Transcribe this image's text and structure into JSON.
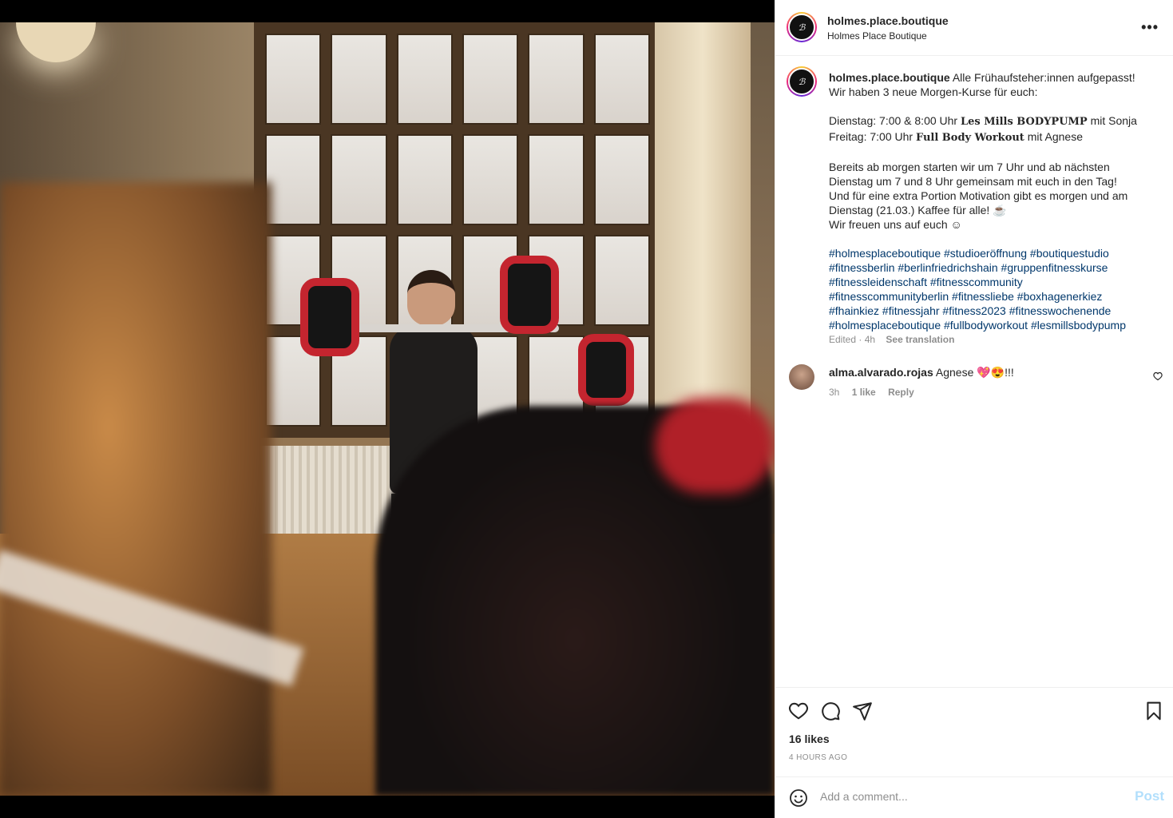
{
  "post": {
    "username": "holmes.place.boutique",
    "subtitle": "Holmes Place Boutique",
    "more": "•••",
    "avatar_text": "ℬ"
  },
  "caption": {
    "username": "holmes.place.boutique",
    "line1": " Alle Frühaufsteher:innen aufgepasst!",
    "line2": "Wir haben 3 neue Morgen-Kurse für euch:",
    "tue_a": "Dienstag: 7:00 & 8:00 Uhr ",
    "tue_b": "Les Mills BODYPUMP",
    "tue_c": " mit Sonja",
    "fri_a": "Freitag: 7:00 Uhr ",
    "fri_b": "Full Body Workout",
    "fri_c": " mit Agnese",
    "p1": "Bereits ab morgen starten wir um 7 Uhr und ab nächsten",
    "p2": "Dienstag um 7 und 8 Uhr gemeinsam mit euch in den Tag!",
    "p3": "Und für eine extra Portion Motivation gibt es morgen und am",
    "p4": "Dienstag (21.03.) Kaffee für alle! ☕",
    "p5": "Wir freuen uns auf euch ☺",
    "tags": [
      "#holmesplaceboutique #studioeröffnung #boutiquestudio",
      "#fitnessberlin #berlinfriedrichshain #gruppenfitnesskurse",
      "#fitnessleidenschaft #fitnesscommunity",
      "#fitnesscommunityberlin #fitnessliebe #boxhagenerkiez",
      "#fhainkiez #fitnessjahr #fitness2023 #fitnesswochenende",
      "#holmesplaceboutique #fullbodyworkout #lesmillsbodypump"
    ],
    "edited": "Edited · 4h",
    "see_translation": "See translation"
  },
  "comment": {
    "username": "alma.alvarado.rojas",
    "text": " Agnese 💖😍!!!",
    "time": "3h",
    "likes": "1 like",
    "reply": "Reply"
  },
  "stats": {
    "likes": "16 likes",
    "ago": "4 HOURS AGO"
  },
  "add_comment": {
    "placeholder": "Add a comment...",
    "post": "Post"
  }
}
